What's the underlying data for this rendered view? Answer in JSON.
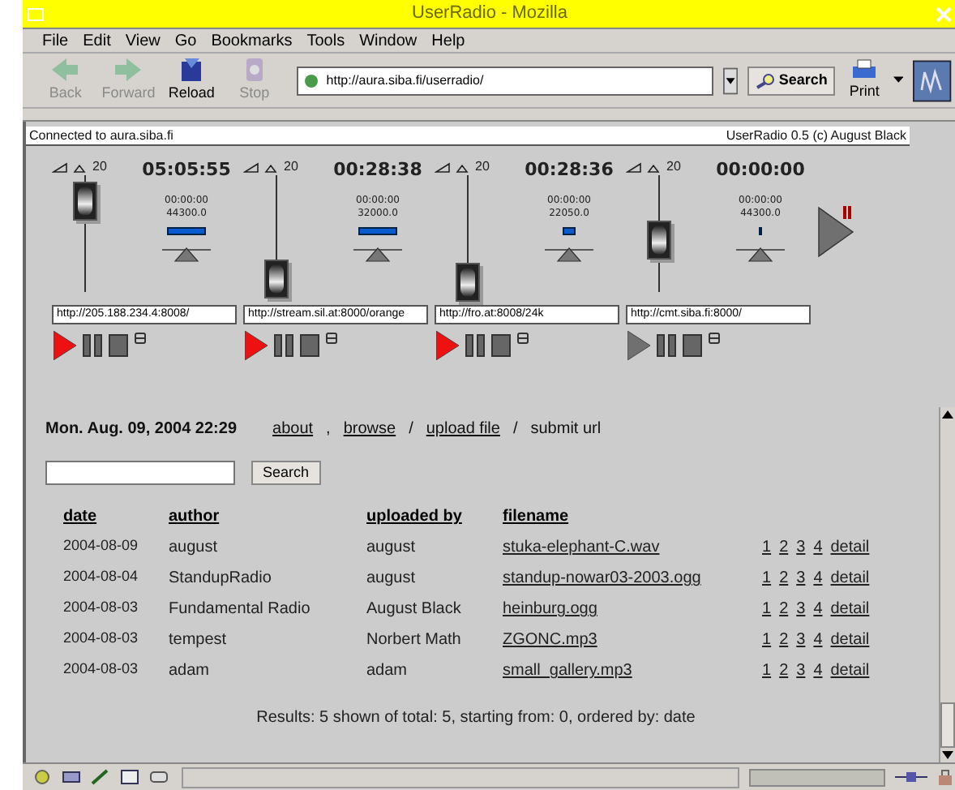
{
  "window": {
    "title": "UserRadio - Mozilla"
  },
  "menu": [
    "File",
    "Edit",
    "View",
    "Go",
    "Bookmarks",
    "Tools",
    "Window",
    "Help"
  ],
  "toolbar": {
    "buttons": [
      {
        "label": "Back",
        "kind": "back",
        "disabled": true
      },
      {
        "label": "Forward",
        "kind": "forward",
        "disabled": true
      },
      {
        "label": "Reload",
        "kind": "reload",
        "disabled": false
      },
      {
        "label": "Stop",
        "kind": "stop",
        "disabled": true
      }
    ],
    "url": "http://aura.siba.fi/userradio/",
    "search": "Search",
    "print": "Print"
  },
  "applet": {
    "status": "Connected to aura.siba.fi",
    "credit": "UserRadio 0.5 (c) August Black",
    "decks": [
      {
        "volume": "20",
        "time": "05:05:55",
        "position": "00:00:00",
        "rate": "44300.0",
        "url": "http://205.188.234.4:8008/",
        "playing": true
      },
      {
        "volume": "20",
        "time": "00:28:38",
        "position": "00:00:00",
        "rate": "32000.0",
        "url": "http://stream.sil.at:8000/orange",
        "playing": true
      },
      {
        "volume": "20",
        "time": "00:28:36",
        "position": "00:00:00",
        "rate": "22050.0",
        "url": "http://fro.at:8008/24k",
        "playing": true
      },
      {
        "volume": "20",
        "time": "00:00:00",
        "position": "00:00:00",
        "rate": "44300.0",
        "url": "http://cmt.siba.fi:8000/",
        "playing": false
      }
    ]
  },
  "page": {
    "datetime": "Mon. Aug. 09, 2004 22:29",
    "nav": [
      {
        "label": "about",
        "kind": "link"
      },
      {
        "label": ",",
        "kind": "text"
      },
      {
        "label": "browse",
        "kind": "link"
      },
      {
        "label": "/",
        "kind": "text"
      },
      {
        "label": "upload file",
        "kind": "link"
      },
      {
        "label": "/",
        "kind": "text"
      },
      {
        "label": "submit url",
        "kind": "text"
      }
    ],
    "search_button": "Search",
    "columns": [
      "date",
      "author",
      "uploaded by",
      "filename"
    ],
    "rows": [
      {
        "date": "2004-08-09",
        "author": "august",
        "uploaded_by": "august",
        "filename": "stuka-elephant-C.wav",
        "links": [
          "1",
          "2",
          "3",
          "4",
          "detail"
        ]
      },
      {
        "date": "2004-08-04",
        "author": "StandupRadio",
        "uploaded_by": "august",
        "filename": "standup-nowar03-2003.ogg",
        "links": [
          "1",
          "2",
          "3",
          "4",
          "detail"
        ]
      },
      {
        "date": "2004-08-03",
        "author": "Fundamental Radio",
        "uploaded_by": "August Black",
        "filename": "heinburg.ogg",
        "links": [
          "1",
          "2",
          "3",
          "4",
          "detail"
        ]
      },
      {
        "date": "2004-08-03",
        "author": "tempest",
        "uploaded_by": "Norbert Math",
        "filename": "ZGONC.mp3",
        "links": [
          "1",
          "2",
          "3",
          "4",
          "detail"
        ]
      },
      {
        "date": "2004-08-03",
        "author": "adam",
        "uploaded_by": "adam",
        "filename": "small_gallery.mp3",
        "links": [
          "1",
          "2",
          "3",
          "4",
          "detail"
        ]
      }
    ],
    "results": "Results: 5 shown of total: 5, starting from: 0, ordered by: date"
  }
}
